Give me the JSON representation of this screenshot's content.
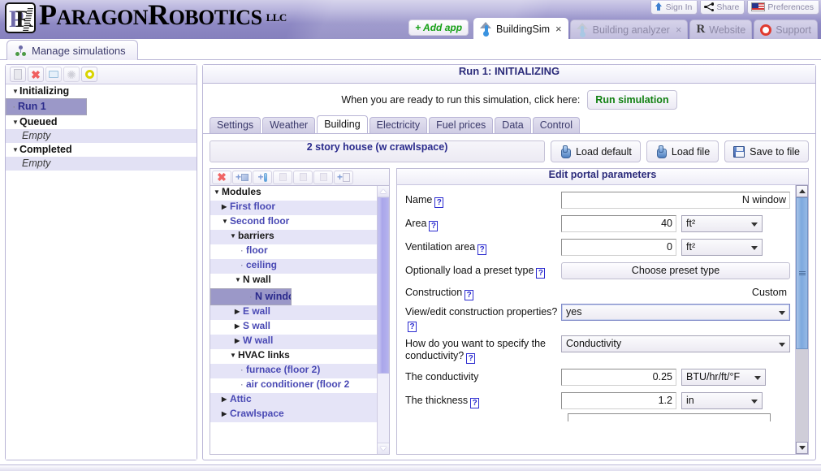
{
  "brand": {
    "name_part1": "P",
    "name_part1_rest": "ARAGON",
    "name_part2": "R",
    "name_part2_rest": "OBOTICS",
    "suffix": "LLC"
  },
  "account_bar": [
    {
      "label": "Sign In",
      "icon": "arrow-up-icon"
    },
    {
      "label": "Share",
      "icon": "share-icon"
    },
    {
      "label": "Preferences",
      "icon": "us-flag-icon"
    }
  ],
  "app_tabs": {
    "add_app_label": "+ Add app",
    "tabs": [
      {
        "label": "BuildingSim",
        "icon": "thermometer-house-icon",
        "active": true,
        "closable": true,
        "close_label": "×"
      },
      {
        "label": "Building analyzer",
        "icon": "thermometer-house-icon",
        "active": false,
        "closable": true,
        "close_label": "×"
      },
      {
        "label": "Website",
        "icon": "paragon-r-icon",
        "active": false,
        "closable": false
      },
      {
        "label": "Support",
        "icon": "life-ring-icon",
        "active": false,
        "closable": false
      }
    ]
  },
  "page_tab": {
    "label": "Manage simulations",
    "icon": "nodes-icon"
  },
  "sim_panel": {
    "toolbar": [
      {
        "name": "new-simulation-button",
        "icon": "page-icon"
      },
      {
        "name": "delete-simulation-button",
        "icon": "red-x-icon"
      },
      {
        "name": "notes-button",
        "icon": "note-icon"
      },
      {
        "name": "settings-button",
        "icon": "gear-icon"
      },
      {
        "name": "status-button",
        "icon": "yellow-ring-icon"
      }
    ],
    "groups": [
      {
        "label": "Initializing",
        "expanded": true,
        "items": [
          {
            "label": "Run 1",
            "selected": true
          }
        ]
      },
      {
        "label": "Queued",
        "expanded": true,
        "items": [
          {
            "label": "Empty",
            "empty": true
          }
        ]
      },
      {
        "label": "Completed",
        "expanded": true,
        "items": [
          {
            "label": "Empty",
            "empty": true
          }
        ]
      }
    ]
  },
  "main": {
    "run_title": "Run 1: INITIALIZING",
    "run_prompt": "When you are ready to run this simulation, click here:",
    "run_button": "Run simulation",
    "subtabs": [
      {
        "label": "Settings",
        "active": false
      },
      {
        "label": "Weather",
        "active": false
      },
      {
        "label": "Building",
        "active": true
      },
      {
        "label": "Electricity",
        "active": false
      },
      {
        "label": "Fuel prices",
        "active": false
      },
      {
        "label": "Data",
        "active": false
      },
      {
        "label": "Control",
        "active": false
      }
    ],
    "file_row": {
      "project_name": "2 story house (w crawlspace)",
      "load_default": "Load default",
      "load_file": "Load file",
      "save_to_file": "Save to file"
    },
    "module_toolbar": [
      {
        "name": "delete-module-button",
        "icon": "red-x-icon"
      },
      {
        "name": "add-module-button",
        "icon": "add-cube-icon"
      },
      {
        "name": "add-sensor-button",
        "icon": "add-thermometer-icon"
      },
      {
        "name": "disabled-button-1",
        "icon": "ghost-icon"
      },
      {
        "name": "disabled-button-2",
        "icon": "ghost-icon"
      },
      {
        "name": "disabled-button-3",
        "icon": "ghost-icon"
      },
      {
        "name": "add-portal-button",
        "icon": "add-page-icon"
      }
    ],
    "module_tree": [
      {
        "label": "Modules",
        "depth": 0,
        "caret": "▼",
        "style": "root"
      },
      {
        "label": "First floor",
        "depth": 1,
        "caret": "▶",
        "style": "link"
      },
      {
        "label": "Second floor",
        "depth": 1,
        "caret": "▼",
        "style": "link"
      },
      {
        "label": "barriers",
        "depth": 2,
        "caret": "▼",
        "style": "dark"
      },
      {
        "label": "floor",
        "depth": 3,
        "caret": "·",
        "style": "link"
      },
      {
        "label": "ceiling",
        "depth": 3,
        "caret": "·",
        "style": "link"
      },
      {
        "label": "N wall",
        "depth": 3,
        "caret": "▼",
        "style": "dark"
      },
      {
        "label": "N window",
        "depth": 4,
        "caret": "·",
        "style": "selected"
      },
      {
        "label": "E wall",
        "depth": 3,
        "caret": "▶",
        "style": "link"
      },
      {
        "label": "S wall",
        "depth": 3,
        "caret": "▶",
        "style": "link"
      },
      {
        "label": "W wall",
        "depth": 3,
        "caret": "▶",
        "style": "link"
      },
      {
        "label": "HVAC links",
        "depth": 2,
        "caret": "▼",
        "style": "dark"
      },
      {
        "label": "furnace (floor 2)",
        "depth": 3,
        "caret": "·",
        "style": "link"
      },
      {
        "label": "air conditioner (floor 2",
        "depth": 3,
        "caret": "·",
        "style": "link"
      },
      {
        "label": "Attic",
        "depth": 1,
        "caret": "▶",
        "style": "link"
      },
      {
        "label": "Crawlspace",
        "depth": 1,
        "caret": "▶",
        "style": "link"
      }
    ],
    "params": {
      "title": "Edit portal parameters",
      "name": {
        "label": "Name",
        "help": "?",
        "value": "N window"
      },
      "area": {
        "label": "Area",
        "help": "?",
        "value": "40",
        "unit": "ft²"
      },
      "ventilation_area": {
        "label": "Ventilation area",
        "help": "?",
        "value": "0",
        "unit": "ft²"
      },
      "preset": {
        "label": "Optionally load a preset type",
        "help": "?",
        "button": "Choose preset type"
      },
      "construction": {
        "label": "Construction",
        "help": "?",
        "value": "Custom"
      },
      "view_edit": {
        "label": "View/edit construction properties?",
        "help": "?",
        "value": "yes"
      },
      "conductivity_mode": {
        "label": "How do you want to specify the conductivity?",
        "help": "?",
        "value": "Conductivity"
      },
      "conductivity": {
        "label": "The conductivity",
        "value": "0.25",
        "unit": "BTU/hr/ft/°F"
      },
      "thickness": {
        "label": "The thickness",
        "help": "?",
        "value": "1.2",
        "unit": "in"
      }
    }
  },
  "colors": {
    "header_purple": "#8580bd",
    "accent_blue": "#4949b4",
    "selection": "#9b98c8",
    "run_green": "#128012",
    "title_navy": "#2b2b7a"
  }
}
